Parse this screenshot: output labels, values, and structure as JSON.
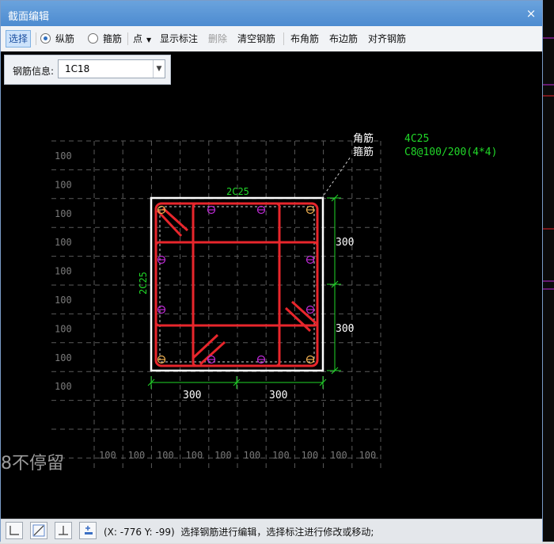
{
  "window": {
    "title": "截面编辑",
    "close_symbol": "×"
  },
  "toolbar": {
    "select": "选择",
    "longitudinal": "纵筋",
    "stirrup": "箍筋",
    "point": "点",
    "show_annotation": "显示标注",
    "delete": "删除",
    "clear_rebar": "清空钢筋",
    "corner_rebar": "布角筋",
    "edge_rebar": "布边筋",
    "align_rebar": "对齐钢筋"
  },
  "rebar_info": {
    "label": "钢筋信息:",
    "value": "1C18"
  },
  "drawing": {
    "labels": {
      "corner": "角筋",
      "stirrup": "箍筋",
      "corner_value": "4C25",
      "stirrup_value": "C8@100/200(4*4)",
      "top_edge": "2C25",
      "left_edge": "2C25",
      "dim_bottom_left": "300",
      "dim_bottom_right": "300",
      "dim_right_top": "300",
      "dim_right_bottom": "300",
      "grid_step": "100"
    },
    "colors": {
      "background": "#000000",
      "section": "#ffffff",
      "rebar": "#e8262c",
      "dimension": "#21d829",
      "bar_marker": "#c02ad8",
      "grid": "#5a5a5a"
    }
  },
  "status": {
    "coords": "(X: -776 Y: -99)",
    "message": "选择钢筋进行编辑，选择标注进行修改或移动;"
  },
  "watermark": "8不停留"
}
